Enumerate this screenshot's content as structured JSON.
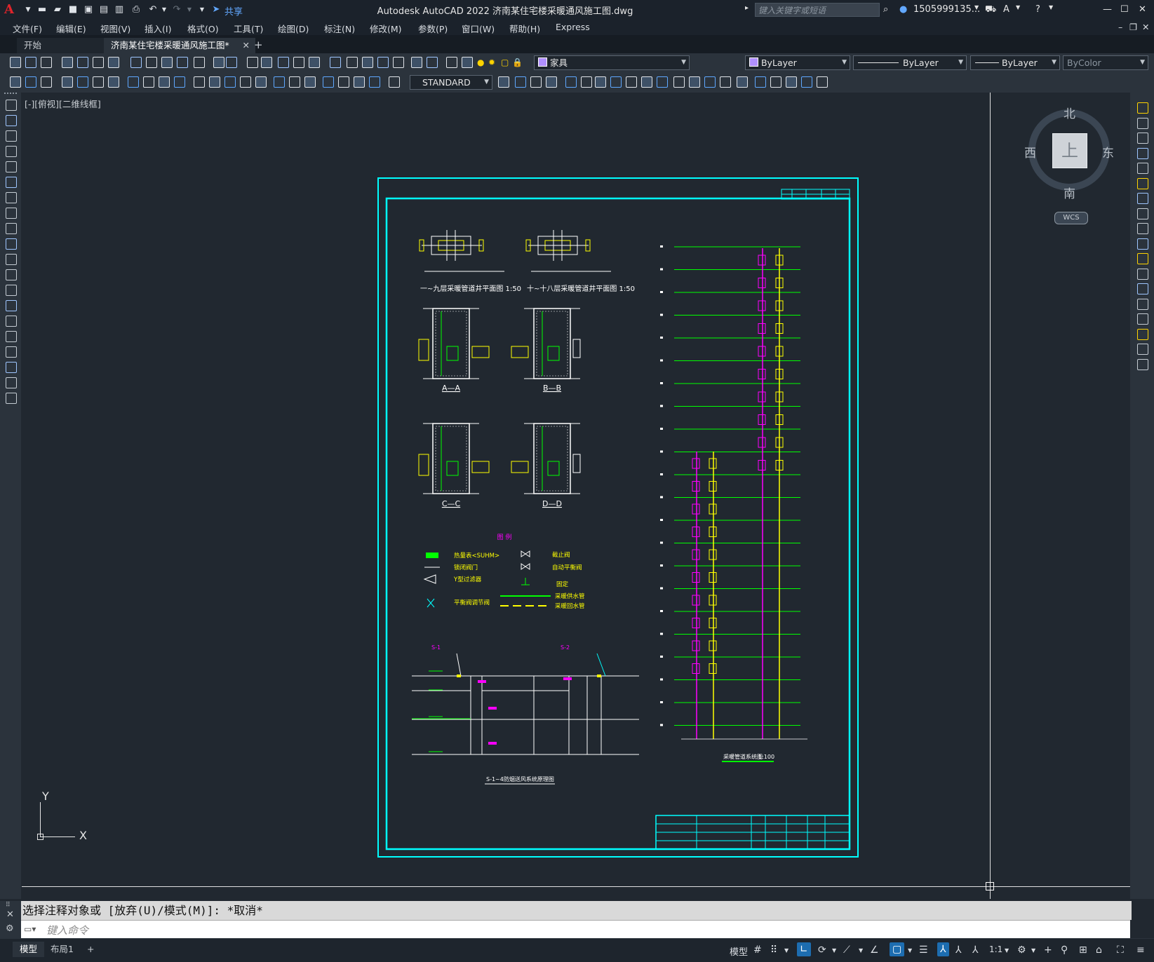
{
  "app": {
    "title": "Autodesk AutoCAD 2022    济南某住宅楼采暖通风施工图.dwg",
    "share": "共享",
    "search_placeholder": "键入关键字或短语",
    "user": "1505999135...",
    "logo": "A"
  },
  "menu": [
    "文件(F)",
    "编辑(E)",
    "视图(V)",
    "插入(I)",
    "格式(O)",
    "工具(T)",
    "绘图(D)",
    "标注(N)",
    "修改(M)",
    "参数(P)",
    "窗口(W)",
    "帮助(H)",
    "Express"
  ],
  "tabs": {
    "start": "开始",
    "active": "济南某住宅楼采暖通风施工图*",
    "add": "+"
  },
  "toolbar": {
    "layer": "家具",
    "color": "ByLayer",
    "linetype": "ByLayer",
    "lineweight": "ByLayer",
    "plotstyle": "ByColor",
    "textstyle": "STANDARD"
  },
  "viewport": {
    "label": "[-][俯视][二维线框]"
  },
  "viewcube": {
    "north": "北",
    "south": "南",
    "east": "东",
    "west": "西",
    "face": "上",
    "wcs": "WCS"
  },
  "ucs": {
    "x": "X",
    "y": "Y"
  },
  "drawing": {
    "plan1_title": "一~九层采暖管道井平面图  1:50",
    "plan2_title": "十~十八层采暖管道井平面图  1:50",
    "section_aa": "A—A",
    "section_bb": "B—B",
    "section_cc": "C—C",
    "section_dd": "D—D",
    "legend_title": "图 例",
    "legend": [
      {
        "label": "热量表<SUHM>",
        "color": "#ffff00"
      },
      {
        "label": "锁闭阀门",
        "color": "#ffff00"
      },
      {
        "label": "Y型过滤器",
        "color": "#ffff00"
      },
      {
        "label": "平衡阀调节阀",
        "color": "#ffff00"
      },
      {
        "label": "截止阀",
        "color": "#ffff00"
      },
      {
        "label": "自动平衡阀",
        "color": "#ffff00"
      },
      {
        "label": "固定",
        "color": "#ffff00"
      },
      {
        "label": "采暖供水管",
        "color": "#ffff00"
      },
      {
        "label": "采暖回水管",
        "color": "#ffff00"
      }
    ],
    "system_title": "采暖管道系统图",
    "system_scale": "1:100",
    "bottom_label1": "S-1",
    "bottom_label2": "S-2",
    "bottom_title": "S-1~4防烟送风系统原理图"
  },
  "command": {
    "history": "选择注释对象或 [放弃(U)/模式(M)]: *取消*",
    "placeholder": "键入命令"
  },
  "status": {
    "model_tab": "模型",
    "layout_tab": "布局1",
    "add_tab": "+",
    "model": "模型",
    "scale": "1:1"
  },
  "colors": {
    "frame": "#00ffff",
    "grid": "#00ff00",
    "supply": "#ffff00",
    "return": "#ff00ff",
    "canvas": "#212830",
    "accent": "#1d6db0"
  }
}
